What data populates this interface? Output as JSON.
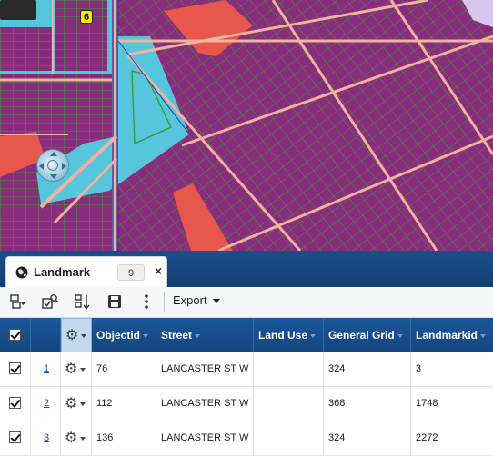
{
  "map": {
    "marker_label": "6",
    "colors": {
      "parcel": "#8a2c7e",
      "road": "#f3b1a0",
      "water": "#55c6dc",
      "industrial": "#e8574b",
      "parcel_line": "#3c9a35",
      "highway": "#1f3fa0"
    }
  },
  "layer_tab": {
    "title": "Landmark",
    "count": "9",
    "close_glyph": "×"
  },
  "toolbar": {
    "export_label": "Export"
  },
  "grid": {
    "columns": [
      "Objectid",
      "Street",
      "Land Use",
      "General Grid",
      "Landmarkid"
    ],
    "rows": [
      {
        "link": "1",
        "objectid": "76",
        "street": "LANCASTER ST W",
        "land_use": "",
        "general_grid": "324",
        "landmarkid": "3"
      },
      {
        "link": "2",
        "objectid": "112",
        "street": "LANCASTER ST W",
        "land_use": "",
        "general_grid": "368",
        "landmarkid": "1748"
      },
      {
        "link": "3",
        "objectid": "136",
        "street": "LANCASTER ST W",
        "land_use": "",
        "general_grid": "324",
        "landmarkid": "2272"
      }
    ]
  }
}
